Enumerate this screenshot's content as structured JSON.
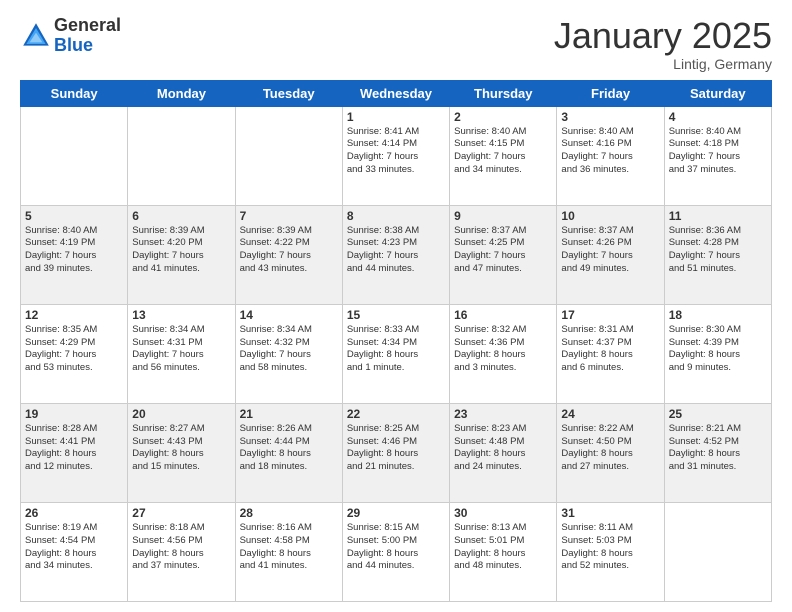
{
  "header": {
    "logo_general": "General",
    "logo_blue": "Blue",
    "month_title": "January 2025",
    "location": "Lintig, Germany"
  },
  "days_of_week": [
    "Sunday",
    "Monday",
    "Tuesday",
    "Wednesday",
    "Thursday",
    "Friday",
    "Saturday"
  ],
  "weeks": [
    {
      "shaded": false,
      "days": [
        {
          "num": "",
          "info": ""
        },
        {
          "num": "",
          "info": ""
        },
        {
          "num": "",
          "info": ""
        },
        {
          "num": "1",
          "info": "Sunrise: 8:41 AM\nSunset: 4:14 PM\nDaylight: 7 hours\nand 33 minutes."
        },
        {
          "num": "2",
          "info": "Sunrise: 8:40 AM\nSunset: 4:15 PM\nDaylight: 7 hours\nand 34 minutes."
        },
        {
          "num": "3",
          "info": "Sunrise: 8:40 AM\nSunset: 4:16 PM\nDaylight: 7 hours\nand 36 minutes."
        },
        {
          "num": "4",
          "info": "Sunrise: 8:40 AM\nSunset: 4:18 PM\nDaylight: 7 hours\nand 37 minutes."
        }
      ]
    },
    {
      "shaded": true,
      "days": [
        {
          "num": "5",
          "info": "Sunrise: 8:40 AM\nSunset: 4:19 PM\nDaylight: 7 hours\nand 39 minutes."
        },
        {
          "num": "6",
          "info": "Sunrise: 8:39 AM\nSunset: 4:20 PM\nDaylight: 7 hours\nand 41 minutes."
        },
        {
          "num": "7",
          "info": "Sunrise: 8:39 AM\nSunset: 4:22 PM\nDaylight: 7 hours\nand 43 minutes."
        },
        {
          "num": "8",
          "info": "Sunrise: 8:38 AM\nSunset: 4:23 PM\nDaylight: 7 hours\nand 44 minutes."
        },
        {
          "num": "9",
          "info": "Sunrise: 8:37 AM\nSunset: 4:25 PM\nDaylight: 7 hours\nand 47 minutes."
        },
        {
          "num": "10",
          "info": "Sunrise: 8:37 AM\nSunset: 4:26 PM\nDaylight: 7 hours\nand 49 minutes."
        },
        {
          "num": "11",
          "info": "Sunrise: 8:36 AM\nSunset: 4:28 PM\nDaylight: 7 hours\nand 51 minutes."
        }
      ]
    },
    {
      "shaded": false,
      "days": [
        {
          "num": "12",
          "info": "Sunrise: 8:35 AM\nSunset: 4:29 PM\nDaylight: 7 hours\nand 53 minutes."
        },
        {
          "num": "13",
          "info": "Sunrise: 8:34 AM\nSunset: 4:31 PM\nDaylight: 7 hours\nand 56 minutes."
        },
        {
          "num": "14",
          "info": "Sunrise: 8:34 AM\nSunset: 4:32 PM\nDaylight: 7 hours\nand 58 minutes."
        },
        {
          "num": "15",
          "info": "Sunrise: 8:33 AM\nSunset: 4:34 PM\nDaylight: 8 hours\nand 1 minute."
        },
        {
          "num": "16",
          "info": "Sunrise: 8:32 AM\nSunset: 4:36 PM\nDaylight: 8 hours\nand 3 minutes."
        },
        {
          "num": "17",
          "info": "Sunrise: 8:31 AM\nSunset: 4:37 PM\nDaylight: 8 hours\nand 6 minutes."
        },
        {
          "num": "18",
          "info": "Sunrise: 8:30 AM\nSunset: 4:39 PM\nDaylight: 8 hours\nand 9 minutes."
        }
      ]
    },
    {
      "shaded": true,
      "days": [
        {
          "num": "19",
          "info": "Sunrise: 8:28 AM\nSunset: 4:41 PM\nDaylight: 8 hours\nand 12 minutes."
        },
        {
          "num": "20",
          "info": "Sunrise: 8:27 AM\nSunset: 4:43 PM\nDaylight: 8 hours\nand 15 minutes."
        },
        {
          "num": "21",
          "info": "Sunrise: 8:26 AM\nSunset: 4:44 PM\nDaylight: 8 hours\nand 18 minutes."
        },
        {
          "num": "22",
          "info": "Sunrise: 8:25 AM\nSunset: 4:46 PM\nDaylight: 8 hours\nand 21 minutes."
        },
        {
          "num": "23",
          "info": "Sunrise: 8:23 AM\nSunset: 4:48 PM\nDaylight: 8 hours\nand 24 minutes."
        },
        {
          "num": "24",
          "info": "Sunrise: 8:22 AM\nSunset: 4:50 PM\nDaylight: 8 hours\nand 27 minutes."
        },
        {
          "num": "25",
          "info": "Sunrise: 8:21 AM\nSunset: 4:52 PM\nDaylight: 8 hours\nand 31 minutes."
        }
      ]
    },
    {
      "shaded": false,
      "days": [
        {
          "num": "26",
          "info": "Sunrise: 8:19 AM\nSunset: 4:54 PM\nDaylight: 8 hours\nand 34 minutes."
        },
        {
          "num": "27",
          "info": "Sunrise: 8:18 AM\nSunset: 4:56 PM\nDaylight: 8 hours\nand 37 minutes."
        },
        {
          "num": "28",
          "info": "Sunrise: 8:16 AM\nSunset: 4:58 PM\nDaylight: 8 hours\nand 41 minutes."
        },
        {
          "num": "29",
          "info": "Sunrise: 8:15 AM\nSunset: 5:00 PM\nDaylight: 8 hours\nand 44 minutes."
        },
        {
          "num": "30",
          "info": "Sunrise: 8:13 AM\nSunset: 5:01 PM\nDaylight: 8 hours\nand 48 minutes."
        },
        {
          "num": "31",
          "info": "Sunrise: 8:11 AM\nSunset: 5:03 PM\nDaylight: 8 hours\nand 52 minutes."
        },
        {
          "num": "",
          "info": ""
        }
      ]
    }
  ]
}
